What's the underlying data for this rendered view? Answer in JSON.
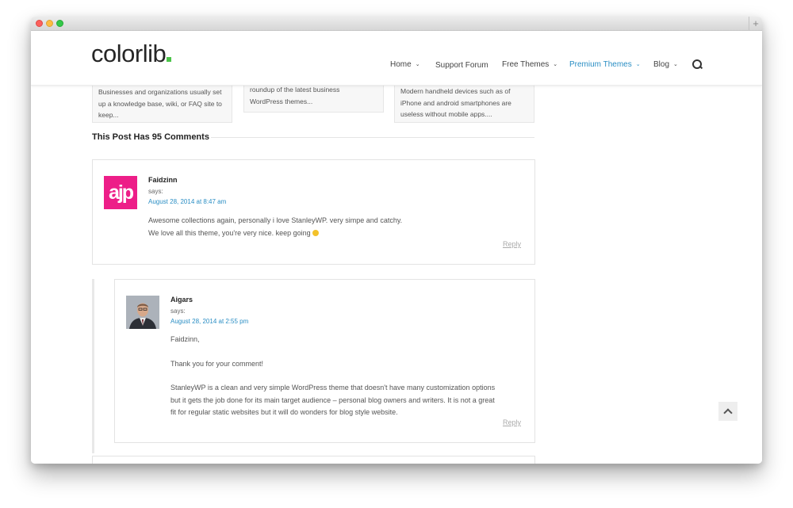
{
  "header": {
    "logo": "colorlib",
    "nav": [
      {
        "label": "Home",
        "dropdown": true,
        "active": false
      },
      {
        "label": "Support Forum",
        "dropdown": false,
        "active": false
      },
      {
        "label": "Free Themes",
        "dropdown": true,
        "active": false
      },
      {
        "label": "Premium Themes",
        "dropdown": true,
        "active": true
      },
      {
        "label": "Blog",
        "dropdown": true,
        "active": false
      }
    ],
    "search_icon": "search-icon"
  },
  "related": [
    {
      "line1": "Businesses and organizations usually set",
      "line2": "up a knowledge base, wiki, or FAQ site to",
      "line3": "keep..."
    },
    {
      "line1": "roundup of the latest business",
      "line2": "WordPress themes..."
    },
    {
      "line1": "Modern handheld devices such as of",
      "line2": "iPhone and android smartphones are",
      "line3": "useless without mobile apps...."
    }
  ],
  "comments_title": "This Post Has 95 Comments",
  "comments": [
    {
      "avatar_text": "ajp",
      "author": "Faidzinn",
      "says": "says:",
      "date": "August 28, 2014 at 8:47 am",
      "line1": "Awesome collections again, personally i love StanleyWP. very simpe and catchy.",
      "line2": "We love all this theme, you're very nice. keep going",
      "reply": "Reply"
    },
    {
      "author": "Aigars",
      "says": "says:",
      "date": "August 28, 2014 at 2:55 pm",
      "greeting": "Faidzinn,",
      "thanks": "Thank you for your comment!",
      "body1": "StanleyWP is a clean and very simple WordPress theme that doesn't have many customization options",
      "body2": "but it gets the job done for its main target audience – personal blog owners and writers. It is not a great",
      "body3": "fit for regular static websites but it will do wonders for blog style website.",
      "reply": "Reply"
    }
  ],
  "colors": {
    "accent": "#2a8ec4",
    "logo_dot": "#4cc44a",
    "avatar_bg": "#ed1e88"
  }
}
